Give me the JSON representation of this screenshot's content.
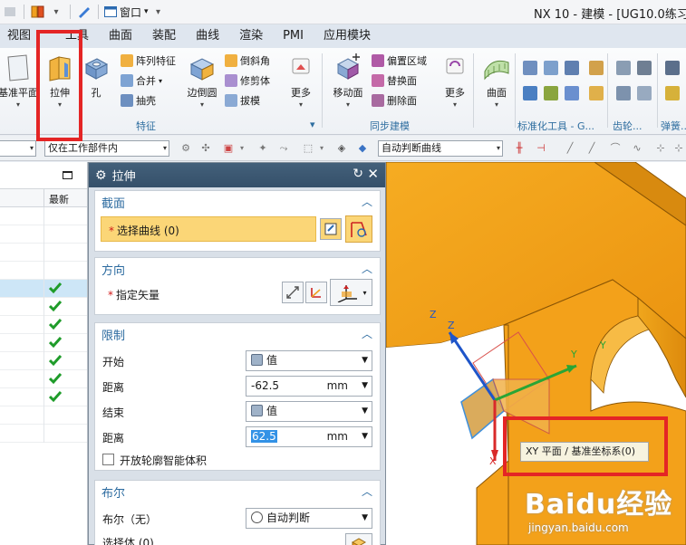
{
  "titlebar": {
    "window_menu": "窗口",
    "title": "NX 10 - 建模 - [UG10.0练习三"
  },
  "menu_tabs": [
    "视图",
    "工具",
    "曲面",
    "装配",
    "曲线",
    "渲染",
    "PMI",
    "应用模块"
  ],
  "ribbon": {
    "datum_plane": "基准平面",
    "extrude": "拉伸",
    "hole": "孔",
    "pattern_feature": "阵列特征",
    "unite": "合并",
    "shell": "抽壳",
    "edge_blend": "边倒圆",
    "chamfer": "倒斜角",
    "trim_body": "修剪体",
    "draft": "拔模",
    "more1": "更多",
    "feature_group": "特征",
    "move_face": "移动面",
    "offset_region": "偏置区域",
    "replace_face": "替换面",
    "delete_face": "删除面",
    "more2": "更多",
    "sync_group": "同步建模",
    "surface": "曲面",
    "standard_tools": "标准化工具 - G...",
    "gear": "齿轮...",
    "spring": "弹簧..."
  },
  "selbar": {
    "scope": "仅在工作部件内",
    "curve_rule": "自动判断曲线"
  },
  "navigator": {
    "column_latest": "最新",
    "checked_rows": 7
  },
  "dialog": {
    "title": "拉伸",
    "section": {
      "header": "截面",
      "select_curve": "选择曲线 (0)"
    },
    "direction": {
      "header": "方向",
      "specify_vector": "指定矢量"
    },
    "limits": {
      "header": "限制",
      "start_label": "开始",
      "start_value": "值",
      "start_distance_label": "距离",
      "start_distance": "-62.5",
      "start_unit": "mm",
      "end_label": "结束",
      "end_value": "值",
      "end_distance_label": "距离",
      "end_distance": "62.5",
      "end_unit": "mm",
      "open_profile": "开放轮廓智能体积"
    },
    "boolean": {
      "header": "布尔",
      "boolean_label": "布尔（无）",
      "boolean_value": "自动判断",
      "select_body": "选择体 (0)"
    }
  },
  "viewport": {
    "tooltip": "XY 平面 / 基准坐标系(0)",
    "axis_z1": "Z",
    "axis_z2": "Z",
    "axis_y1": "Y",
    "axis_y2": "Y",
    "axis_x": "X"
  },
  "watermark": {
    "brand": "Baidu经验",
    "url": "jingyan.baidu.com"
  },
  "colors": {
    "highlight_red": "#e42525",
    "model_orange": "#f5a21a",
    "dialog_header": "#2b6a9f",
    "selection_yellow": "#fbd677"
  }
}
